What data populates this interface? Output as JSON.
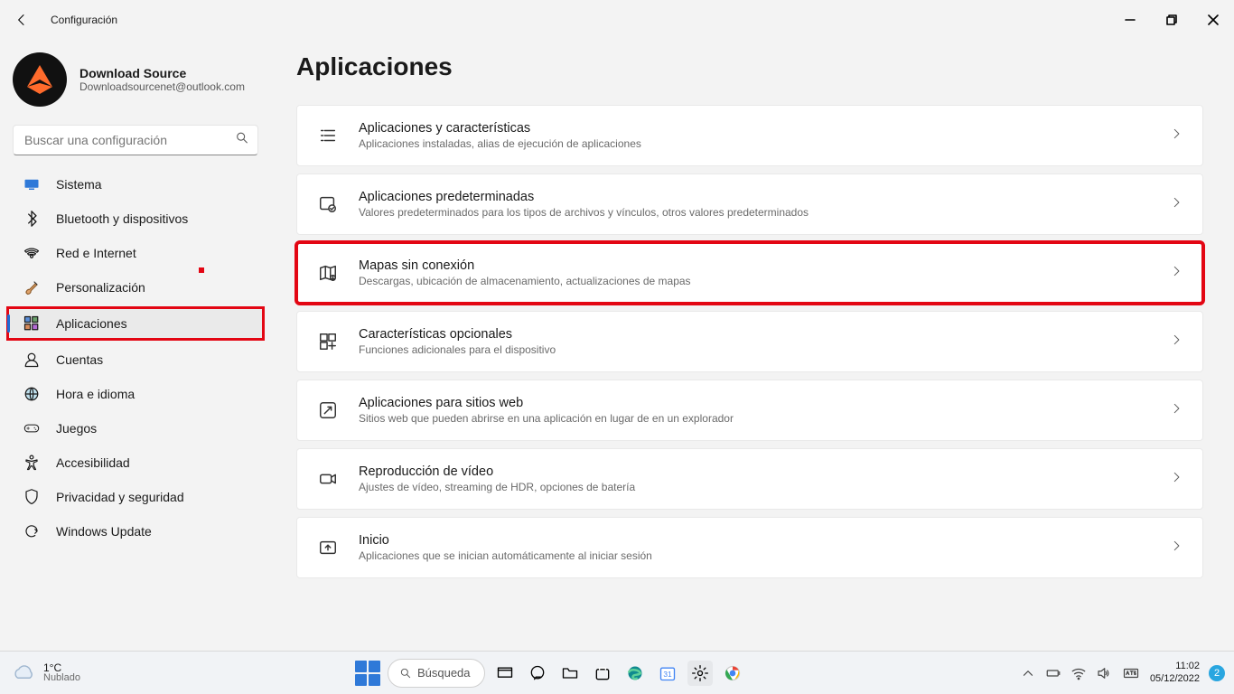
{
  "titlebar": {
    "app_title": "Configuración"
  },
  "profile": {
    "name": "Download Source",
    "email": "Downloadsourcenet@outlook.com"
  },
  "search": {
    "placeholder": "Buscar una configuración"
  },
  "sidebar": {
    "items": [
      {
        "label": "Sistema",
        "icon": "monitor-icon",
        "color": "#2f79d8"
      },
      {
        "label": "Bluetooth y dispositivos",
        "icon": "bluetooth-icon",
        "color": "#2f79d8"
      },
      {
        "label": "Red e Internet",
        "icon": "wifi-icon",
        "color": "#2f79d8"
      },
      {
        "label": "Personalización",
        "icon": "brush-icon",
        "color": "#c0392b"
      },
      {
        "label": "Aplicaciones",
        "icon": "apps-icon",
        "color": "#555",
        "active": true,
        "highlight": true
      },
      {
        "label": "Cuentas",
        "icon": "person-icon",
        "color": "#2ea043"
      },
      {
        "label": "Hora e idioma",
        "icon": "globe-icon",
        "color": "#5a5a5a"
      },
      {
        "label": "Juegos",
        "icon": "gamepad-icon",
        "color": "#888"
      },
      {
        "label": "Accesibilidad",
        "icon": "accessibility-icon",
        "color": "#2f79d8"
      },
      {
        "label": "Privacidad y seguridad",
        "icon": "shield-icon",
        "color": "#888"
      },
      {
        "label": "Windows Update",
        "icon": "update-icon",
        "color": "#2f79d8"
      }
    ]
  },
  "page": {
    "title": "Aplicaciones"
  },
  "cards": [
    {
      "icon": "list-icon",
      "title": "Aplicaciones y características",
      "sub": "Aplicaciones instaladas, alias de ejecución de aplicaciones"
    },
    {
      "icon": "default-apps-icon",
      "title": "Aplicaciones predeterminadas",
      "sub": "Valores predeterminados para los tipos de archivos y vínculos, otros valores predeterminados"
    },
    {
      "icon": "map-icon",
      "title": "Mapas sin conexión",
      "sub": "Descargas, ubicación de almacenamiento, actualizaciones de mapas",
      "highlight": true
    },
    {
      "icon": "features-plus-icon",
      "title": "Características opcionales",
      "sub": "Funciones adicionales para el dispositivo"
    },
    {
      "icon": "web-app-icon",
      "title": "Aplicaciones para sitios web",
      "sub": "Sitios web que pueden abrirse en una aplicación en lugar de en un explorador"
    },
    {
      "icon": "video-icon",
      "title": "Reproducción de vídeo",
      "sub": "Ajustes de vídeo, streaming de HDR, opciones de batería"
    },
    {
      "icon": "startup-icon",
      "title": "Inicio",
      "sub": "Aplicaciones que se inician automáticamente al iniciar sesión"
    }
  ],
  "taskbar": {
    "weather": {
      "temp": "1°C",
      "desc": "Nublado"
    },
    "search_label": "Búsqueda",
    "time": "11:02",
    "date": "05/12/2022",
    "notif_count": "2"
  }
}
